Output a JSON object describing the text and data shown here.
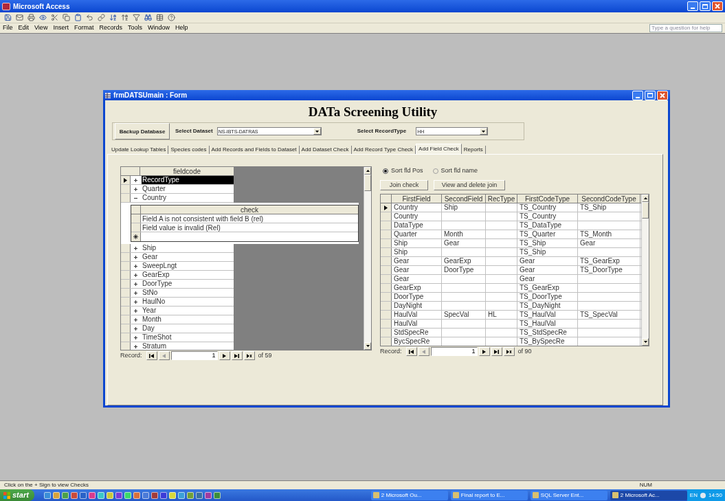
{
  "app": {
    "title": "Microsoft Access"
  },
  "menu": [
    "File",
    "Edit",
    "View",
    "Insert",
    "Format",
    "Records",
    "Tools",
    "Window",
    "Help"
  ],
  "help_box": {
    "placeholder": "Type a question for help"
  },
  "form": {
    "title": "frmDATSUmain : Form",
    "heading": "DATa Screening Utility",
    "backup_button": "Backup Database",
    "dataset": {
      "label": "Select Dataset",
      "value": "NS-IBTS-DATRAS"
    },
    "record_type": {
      "label": "Select RecordType",
      "value": "HH"
    },
    "tabs": [
      {
        "label": "Update Lookup Tables",
        "selected": false
      },
      {
        "label": "Species codes",
        "selected": false
      },
      {
        "label": "Add Records and Fields to Dataset",
        "selected": false
      },
      {
        "label": "Add Dataset Check",
        "selected": false
      },
      {
        "label": "Add Record Type Check",
        "selected": false
      },
      {
        "label": "Add Field Check",
        "selected": true
      },
      {
        "label": "Reports",
        "selected": false
      }
    ],
    "fields": {
      "column": "fieldcode",
      "rows": [
        {
          "value": "RecordType",
          "selected": true,
          "expanded": false
        },
        {
          "value": "Quarter",
          "selected": false,
          "expanded": false
        },
        {
          "value": "Country",
          "selected": false,
          "expanded": true,
          "checks": {
            "column": "check",
            "rows": [
              "Field A is not consistent with field B (rel)",
              "Field value is invalid (Rel)"
            ]
          }
        },
        {
          "value": "Ship",
          "selected": false,
          "expanded": false
        },
        {
          "value": "Gear",
          "selected": false,
          "expanded": false
        },
        {
          "value": "SweepLngt",
          "selected": false,
          "expanded": false
        },
        {
          "value": "GearExp",
          "selected": false,
          "expanded": false
        },
        {
          "value": "DoorType",
          "selected": false,
          "expanded": false
        },
        {
          "value": "StNo",
          "selected": false,
          "expanded": false
        },
        {
          "value": "HaulNo",
          "selected": false,
          "expanded": false
        },
        {
          "value": "Year",
          "selected": false,
          "expanded": false
        },
        {
          "value": "Month",
          "selected": false,
          "expanded": false
        },
        {
          "value": "Day",
          "selected": false,
          "expanded": false
        },
        {
          "value": "TimeShot",
          "selected": false,
          "expanded": false
        },
        {
          "value": "Stratum",
          "selected": false,
          "expanded": false
        }
      ],
      "navigator": {
        "label": "Record:",
        "current": "1",
        "total": "of 59"
      }
    },
    "joins": {
      "sort_options": [
        {
          "label": "Sort fld Pos",
          "selected": true
        },
        {
          "label": "Sort fld name",
          "selected": false
        }
      ],
      "buttons": [
        "Join check",
        "View and delete join"
      ],
      "columns": [
        "FirstField",
        "SecondField",
        "RecType",
        "FirstCodeType",
        "SecondCodeType"
      ],
      "rows": [
        {
          "selected": true,
          "cells": [
            "Country",
            "Ship",
            "",
            "TS_Country",
            "TS_Ship"
          ]
        },
        {
          "selected": false,
          "cells": [
            "Country",
            "",
            "",
            "TS_Country",
            ""
          ]
        },
        {
          "selected": false,
          "cells": [
            "DataType",
            "",
            "",
            "TS_DataType",
            ""
          ]
        },
        {
          "selected": false,
          "cells": [
            "Quarter",
            "Month",
            "",
            "TS_Quarter",
            "TS_Month"
          ]
        },
        {
          "selected": false,
          "cells": [
            "Ship",
            "Gear",
            "",
            "TS_Ship",
            "Gear"
          ]
        },
        {
          "selected": false,
          "cells": [
            "Ship",
            "",
            "",
            "TS_Ship",
            ""
          ]
        },
        {
          "selected": false,
          "cells": [
            "Gear",
            "GearExp",
            "",
            "Gear",
            "TS_GearExp"
          ]
        },
        {
          "selected": false,
          "cells": [
            "Gear",
            "DoorType",
            "",
            "Gear",
            "TS_DoorType"
          ]
        },
        {
          "selected": false,
          "cells": [
            "Gear",
            "",
            "",
            "Gear",
            ""
          ]
        },
        {
          "selected": false,
          "cells": [
            "GearExp",
            "",
            "",
            "TS_GearExp",
            ""
          ]
        },
        {
          "selected": false,
          "cells": [
            "DoorType",
            "",
            "",
            "TS_DoorType",
            ""
          ]
        },
        {
          "selected": false,
          "cells": [
            "DayNight",
            "",
            "",
            "TS_DayNight",
            ""
          ]
        },
        {
          "selected": false,
          "cells": [
            "HaulVal",
            "SpecVal",
            "HL",
            "TS_HaulVal",
            "TS_SpecVal"
          ]
        },
        {
          "selected": false,
          "cells": [
            "HaulVal",
            "",
            "",
            "TS_HaulVal",
            ""
          ]
        },
        {
          "selected": false,
          "cells": [
            "StdSpecRe",
            "",
            "",
            "TS_StdSpecRe",
            ""
          ]
        },
        {
          "selected": false,
          "cells": [
            "BycSpecRe",
            "",
            "",
            "TS_BySpecRe",
            ""
          ]
        }
      ],
      "navigator": {
        "label": "Record:",
        "current": "1",
        "total": "of 90"
      }
    }
  },
  "status_bar": {
    "text": "Click on the + Sign to view Checks",
    "indicator": "NUM"
  },
  "taskbar": {
    "start": "start",
    "tasks": [
      {
        "label": "2 Microsoft Ou...",
        "active": false
      },
      {
        "label": "Final report to E...",
        "active": false
      },
      {
        "label": "SQL Server Ent...",
        "active": false
      },
      {
        "label": "2 Microsoft Ac...",
        "active": true
      }
    ],
    "language": "EN",
    "clock": "14:50"
  }
}
